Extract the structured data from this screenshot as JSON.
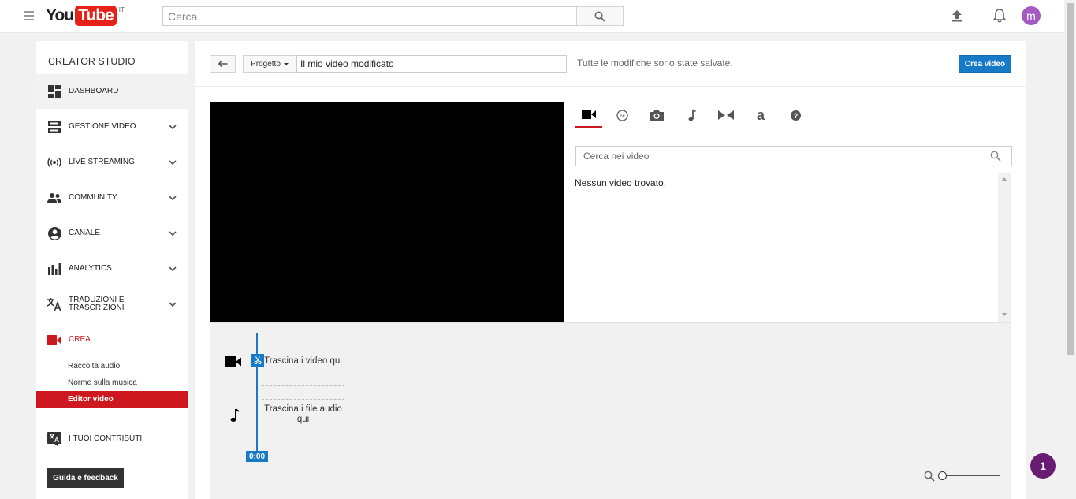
{
  "masthead": {
    "logo_you": "You",
    "logo_tube": "Tube",
    "logo_region": "IT",
    "search_placeholder": "Cerca",
    "avatar_letter": "m"
  },
  "sidebar": {
    "title": "CREATOR STUDIO",
    "items": [
      {
        "label": "DASHBOARD",
        "icon": "dashboard-icon"
      },
      {
        "label": "GESTIONE VIDEO",
        "icon": "video-manager-icon"
      },
      {
        "label": "LIVE STREAMING",
        "icon": "live-streaming-icon"
      },
      {
        "label": "COMMUNITY",
        "icon": "community-icon"
      },
      {
        "label": "CANALE",
        "icon": "channel-icon"
      },
      {
        "label": "ANALYTICS",
        "icon": "analytics-icon"
      },
      {
        "label": "TRADUZIONI E TRASCRIZIONI",
        "icon": "translate-icon"
      },
      {
        "label": "CREA",
        "icon": "create-video-icon"
      }
    ],
    "sub_items": [
      {
        "label": "Raccolta audio"
      },
      {
        "label": "Norme sulla musica"
      },
      {
        "label": "Editor video"
      }
    ],
    "contributions": {
      "label": "I TUOI CONTRIBUTI",
      "icon": "translate-icon"
    },
    "feedback_label": "Guida e feedback"
  },
  "toolbar": {
    "project_label": "Progetto",
    "title_value": "Il mio video modificato",
    "saved_status": "Tutte le modifiche sono state salvate.",
    "create_label": "Crea video"
  },
  "media": {
    "tabs": [
      "video-camera-icon",
      "closed-captions-icon",
      "photo-camera-icon",
      "music-note-icon",
      "transitions-icon",
      "text-icon",
      "help-icon"
    ],
    "search_placeholder": "Cerca nei video",
    "no_results": "Nessun video trovato."
  },
  "timeline": {
    "video_drop": "Trascina i video qui",
    "audio_drop": "Trascina i file audio qui",
    "playhead_time": "0:00"
  },
  "badge": {
    "count": "1"
  },
  "colors": {
    "brand_red": "#cc181e",
    "accent_blue": "#167ac6",
    "badge_purple": "#6a1b72",
    "avatar_purple": "#a55ac3"
  }
}
